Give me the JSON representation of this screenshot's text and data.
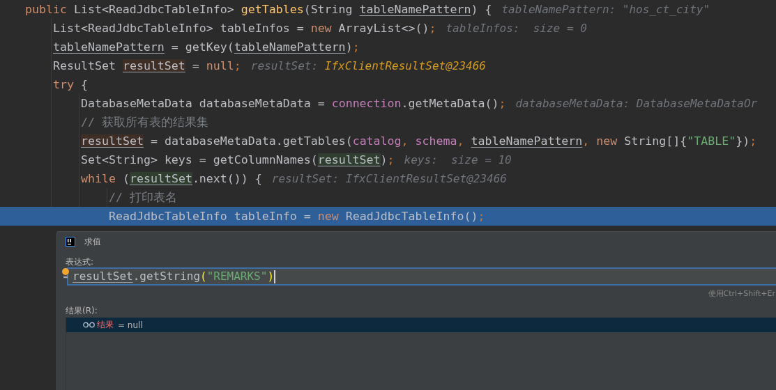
{
  "editor": {
    "lines": [
      {
        "selected": false,
        "tokens": [
          {
            "text": "public ",
            "kind": "kw"
          },
          {
            "text": "List<ReadJdbcTableInfo> ",
            "kind": "plain"
          },
          {
            "text": "getTables",
            "kind": "fn"
          },
          {
            "text": "(String ",
            "kind": "plain"
          },
          {
            "text": "tableNamePattern",
            "kind": "var"
          },
          {
            "text": ") {",
            "kind": "plain"
          }
        ],
        "hint": [
          {
            "text": "tableNamePattern: \"hos_ct_city\"",
            "kind": "name"
          }
        ],
        "children": [
          {
            "selected": false,
            "tokens": [
              {
                "text": "List<ReadJdbcTableInfo> tableInfos = ",
                "kind": "plain"
              },
              {
                "text": "new ",
                "kind": "kw"
              },
              {
                "text": "ArrayList<>()",
                "kind": "plain"
              },
              {
                "text": ";",
                "kind": "semi"
              }
            ],
            "hint": [
              {
                "text": "tableInfos:  size = 0",
                "kind": "name"
              }
            ]
          },
          {
            "selected": false,
            "tokens": [
              {
                "text": "tableNamePattern",
                "kind": "var"
              },
              {
                "text": " = getKey(",
                "kind": "plain"
              },
              {
                "text": "tableNamePattern",
                "kind": "var"
              },
              {
                "text": ")",
                "kind": "plain"
              },
              {
                "text": ";",
                "kind": "semi"
              }
            ]
          },
          {
            "selected": false,
            "tokens": [
              {
                "text": "ResultSet ",
                "kind": "plain"
              },
              {
                "text": "resultSet",
                "kind": "var-write"
              },
              {
                "text": " = ",
                "kind": "plain"
              },
              {
                "text": "null",
                "kind": "kw"
              },
              {
                "text": ";",
                "kind": "semi"
              }
            ],
            "hint": [
              {
                "text": "resultSet: ",
                "kind": "name"
              },
              {
                "text": "IfxClientResultSet@23466",
                "kind": "value"
              }
            ]
          },
          {
            "selected": false,
            "tokens": [
              {
                "text": "try ",
                "kind": "kw"
              },
              {
                "text": "{",
                "kind": "plain"
              }
            ],
            "children": [
              {
                "selected": false,
                "tokens": [
                  {
                    "text": "DatabaseMetaData databaseMetaData = ",
                    "kind": "plain"
                  },
                  {
                    "text": "connection",
                    "kind": "field"
                  },
                  {
                    "text": ".getMetaData()",
                    "kind": "plain"
                  },
                  {
                    "text": ";",
                    "kind": "semi"
                  }
                ],
                "hint": [
                  {
                    "text": "databaseMetaData: DatabaseMetaDataOr",
                    "kind": "name"
                  }
                ]
              },
              {
                "selected": false,
                "tokens": [
                  {
                    "text": "// 获取所有表的结果集",
                    "kind": "comment"
                  }
                ]
              },
              {
                "selected": false,
                "tokens": [
                  {
                    "text": "resultSet",
                    "kind": "var-write"
                  },
                  {
                    "text": " = databaseMetaData.getTables(",
                    "kind": "plain"
                  },
                  {
                    "text": "catalog",
                    "kind": "field"
                  },
                  {
                    "text": ", ",
                    "kind": "semi"
                  },
                  {
                    "text": "schema",
                    "kind": "field"
                  },
                  {
                    "text": ", ",
                    "kind": "semi"
                  },
                  {
                    "text": "tableNamePattern",
                    "kind": "var"
                  },
                  {
                    "text": ", ",
                    "kind": "semi"
                  },
                  {
                    "text": "new ",
                    "kind": "kw"
                  },
                  {
                    "text": "String[]{",
                    "kind": "plain"
                  },
                  {
                    "text": "\"TABLE\"",
                    "kind": "str"
                  },
                  {
                    "text": "})",
                    "kind": "plain"
                  },
                  {
                    "text": ";",
                    "kind": "semi"
                  }
                ]
              },
              {
                "selected": false,
                "tokens": [
                  {
                    "text": "Set<String> keys = getColumnNames(",
                    "kind": "plain"
                  },
                  {
                    "text": "resultSet",
                    "kind": "var-read"
                  },
                  {
                    "text": ")",
                    "kind": "plain"
                  },
                  {
                    "text": ";",
                    "kind": "semi"
                  }
                ],
                "hint": [
                  {
                    "text": "keys:  size = 10",
                    "kind": "name"
                  }
                ]
              },
              {
                "selected": false,
                "tokens": [
                  {
                    "text": "while ",
                    "kind": "kw"
                  },
                  {
                    "text": "(",
                    "kind": "plain"
                  },
                  {
                    "text": "resultSet",
                    "kind": "var-read"
                  },
                  {
                    "text": ".next()) {",
                    "kind": "plain"
                  }
                ],
                "hint": [
                  {
                    "text": "resultSet: IfxClientResultSet@23466",
                    "kind": "name"
                  }
                ],
                "children": [
                  {
                    "selected": false,
                    "tokens": [
                      {
                        "text": "// 打印表名",
                        "kind": "comment"
                      }
                    ]
                  },
                  {
                    "selected": true,
                    "tokens": [
                      {
                        "text": "ReadJdbcTableInfo tableInfo = ",
                        "kind": "plain"
                      },
                      {
                        "text": "new ",
                        "kind": "kw"
                      },
                      {
                        "text": "ReadJdbcTableInfo()",
                        "kind": "plain"
                      },
                      {
                        "text": ";",
                        "kind": "semi"
                      }
                    ]
                  }
                ]
              }
            ]
          }
        ]
      }
    ]
  },
  "dialog": {
    "title": "求值",
    "expression_label": "表达式:",
    "expression": [
      {
        "text": "resultSet",
        "kind": "var"
      },
      {
        "text": ".getString",
        "kind": "plain"
      },
      {
        "text": "(",
        "kind": "brace"
      },
      {
        "text": "\"REMARKS\"",
        "kind": "str"
      },
      {
        "text": ")",
        "kind": "brace"
      }
    ],
    "shortcut_hint": "使用Ctrl+Shift+Er",
    "result_label": "结果(R):",
    "results": [
      {
        "name": "结果",
        "value": "= null",
        "selected": true
      }
    ]
  }
}
